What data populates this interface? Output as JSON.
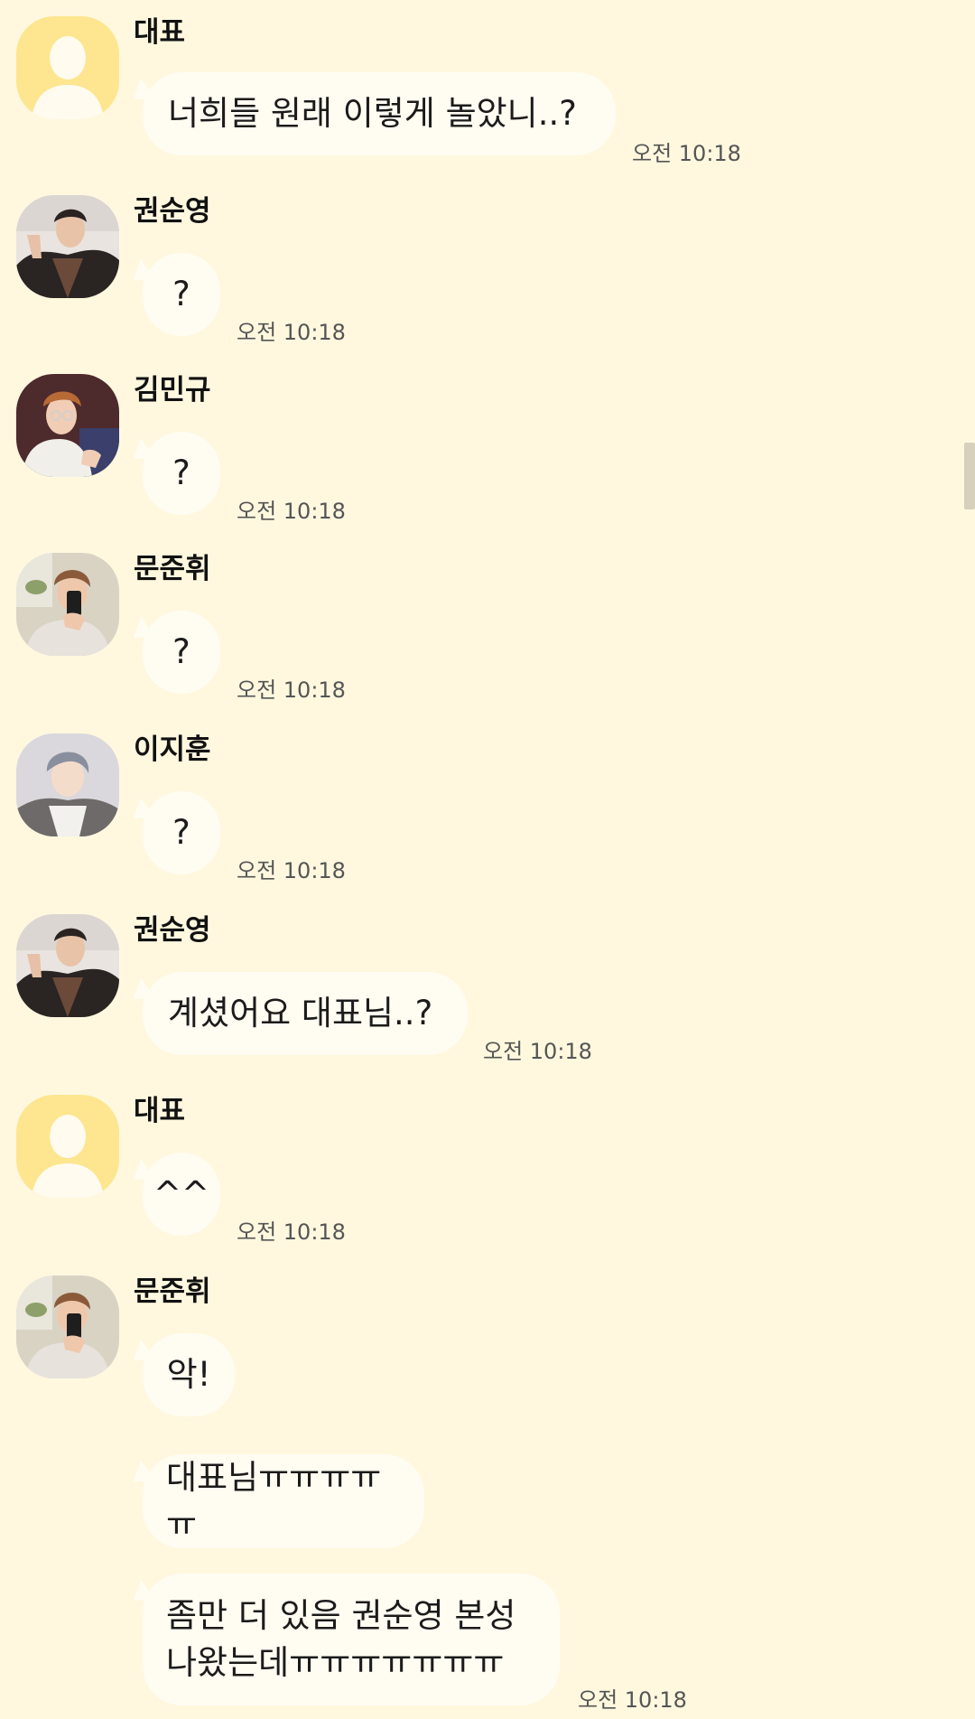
{
  "messages": [
    {
      "sender": "대표",
      "text": "너희들 원래 이렇게 놀았니..?",
      "time": "오전 10:18"
    },
    {
      "sender": "권순영",
      "text": "?",
      "time": "오전 10:18"
    },
    {
      "sender": "김민규",
      "text": "?",
      "time": "오전 10:18"
    },
    {
      "sender": "문준휘",
      "text": "?",
      "time": "오전 10:18"
    },
    {
      "sender": "이지훈",
      "text": "?",
      "time": "오전 10:18"
    },
    {
      "sender": "권순영",
      "text": "계셨어요 대표님..?",
      "time": "오전 10:18"
    },
    {
      "sender": "대표",
      "text": "^^",
      "time": "오전 10:18"
    },
    {
      "sender": "문준휘",
      "text": "악!"
    },
    {
      "text": "대표님ㅠㅠㅠㅠㅠ"
    },
    {
      "text": "좀만 더 있음 권순영 본성\n나왔는데ㅠㅠㅠㅠㅠㅠㅠ",
      "time": "오전 10:18"
    }
  ],
  "icons": {
    "default_avatar": "default-profile-icon",
    "scrollbar": "scrollbar-thumb"
  },
  "colors": {
    "background": "#fff8df",
    "bubble": "#fffcf2",
    "default_avatar_bg": "#fde68f"
  }
}
